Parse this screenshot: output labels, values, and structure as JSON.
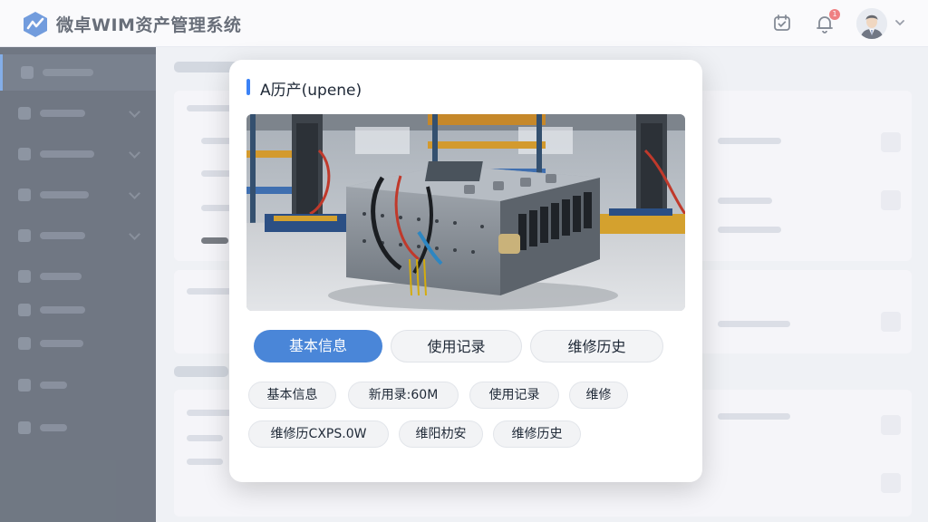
{
  "header": {
    "app_title": "微卓WIM资产管理系统",
    "notification_count": "1",
    "icons": [
      "logo-icon",
      "calendar-check-icon",
      "bell-icon",
      "user-avatar",
      "chevron-down-icon"
    ]
  },
  "modal": {
    "title": "A历产(upene)",
    "tabs": [
      {
        "label": "基本信息",
        "active": true
      },
      {
        "label": "使用记录",
        "active": false
      },
      {
        "label": "维修历史",
        "active": false
      }
    ],
    "chips_row1": [
      "基本信息",
      "新用录:60M",
      "使用记录",
      "维修"
    ],
    "chips_row2": [
      "维修历CXPS.0W",
      "维阳朸安",
      "维修历史"
    ]
  },
  "colors": {
    "primary": "#4a86d8",
    "sidebar_bg": "#2c3645",
    "badge": "#ef4444",
    "title_accent": "#3b82f6"
  }
}
